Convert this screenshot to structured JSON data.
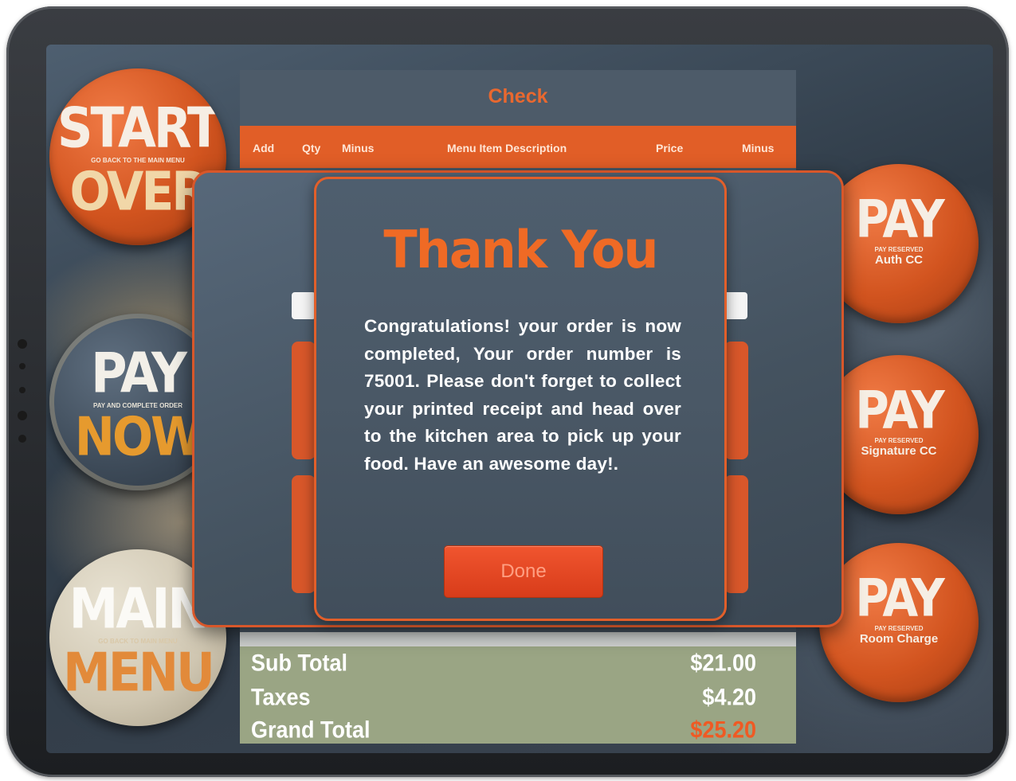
{
  "check": {
    "title": "Check",
    "columns": [
      "Add",
      "Qty",
      "Minus",
      "Menu Item Description",
      "Price",
      "Minus"
    ]
  },
  "totals": {
    "sub_total_label": "Sub Total",
    "sub_total_value": "$21.00",
    "taxes_label": "Taxes",
    "taxes_value": "$4.20",
    "grand_total_label": "Grand Total",
    "grand_total_value": "$25.20"
  },
  "left_buttons": {
    "start_over": {
      "top": "START",
      "tiny": "GO BACK TO THE MAIN MENU",
      "bottom": "OVER"
    },
    "pay_now": {
      "top": "PAY",
      "tiny": "PAY AND COMPLETE ORDER",
      "bottom": "NOW"
    },
    "main_menu": {
      "top": "MAIN",
      "tiny": "GO BACK TO MAIN MENU",
      "bottom": "MENU"
    }
  },
  "right_buttons": {
    "auth_cc": {
      "top": "PAY",
      "tiny": "PAY RESERVED",
      "sub": "Auth CC"
    },
    "signature_cc": {
      "top": "PAY",
      "tiny": "PAY RESERVED",
      "sub": "Signature CC"
    },
    "room_charge": {
      "top": "PAY",
      "tiny": "PAY RESERVED",
      "sub": "Room Charge"
    }
  },
  "dialog": {
    "title": "Thank You",
    "message": "Congratulations! your order is now completed, Your order number is 75001. Please don't forget to collect your printed receipt and head over to the kitchen area to pick up your food. Have an awesome day!.",
    "done_label": "Done"
  },
  "colors": {
    "accent": "#e25f2a",
    "panel": "#4a5866",
    "grand_total": "#ef5a24",
    "totals_bg": "#9aa584"
  }
}
